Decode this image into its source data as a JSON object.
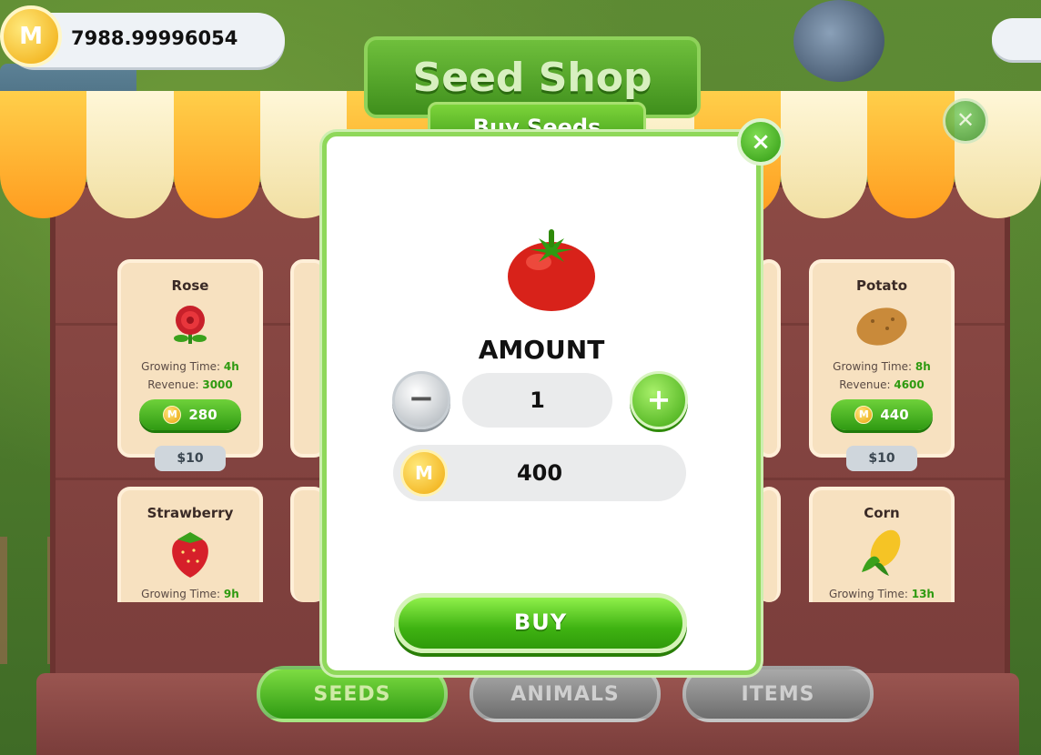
{
  "header": {
    "balance": "7988.99996054",
    "title": "Seed Shop",
    "subtitle": "Buy Seeds"
  },
  "seed_cards": [
    {
      "name": "Rose",
      "growing_label": "Growing Time:",
      "growing_value": "4h",
      "revenue_label": "Revenue:",
      "revenue_value": "3000",
      "coin_price": "280",
      "usd_price": "$10"
    },
    {
      "name": "Potato",
      "growing_label": "Growing Time:",
      "growing_value": "8h",
      "revenue_label": "Revenue:",
      "revenue_value": "4600",
      "coin_price": "440",
      "usd_price": "$10"
    },
    {
      "name": "Strawberry",
      "growing_label": "Growing Time:",
      "growing_value": "9h"
    },
    {
      "name": "Corn",
      "growing_label": "Growing Time:",
      "growing_value": "13h"
    }
  ],
  "modal": {
    "close_label": "×",
    "amount_label": "AMOUNT",
    "minus_label": "−",
    "plus_label": "+",
    "quantity": "1",
    "cost": "400",
    "buy_label": "BUY"
  },
  "tabs": [
    {
      "label": "SEEDS",
      "active": true
    },
    {
      "label": "ANIMALS",
      "active": false
    },
    {
      "label": "ITEMS",
      "active": false
    }
  ],
  "icons": {
    "coin": "coin-icon",
    "tomato": "tomato-icon",
    "rose": "rose-icon",
    "potato": "potato-icon",
    "strawberry": "strawberry-icon",
    "corn": "corn-icon"
  },
  "colors": {
    "accent_green": "#3fb312",
    "coin_gold": "#f0a90c",
    "stall_red": "#8c4a45"
  }
}
